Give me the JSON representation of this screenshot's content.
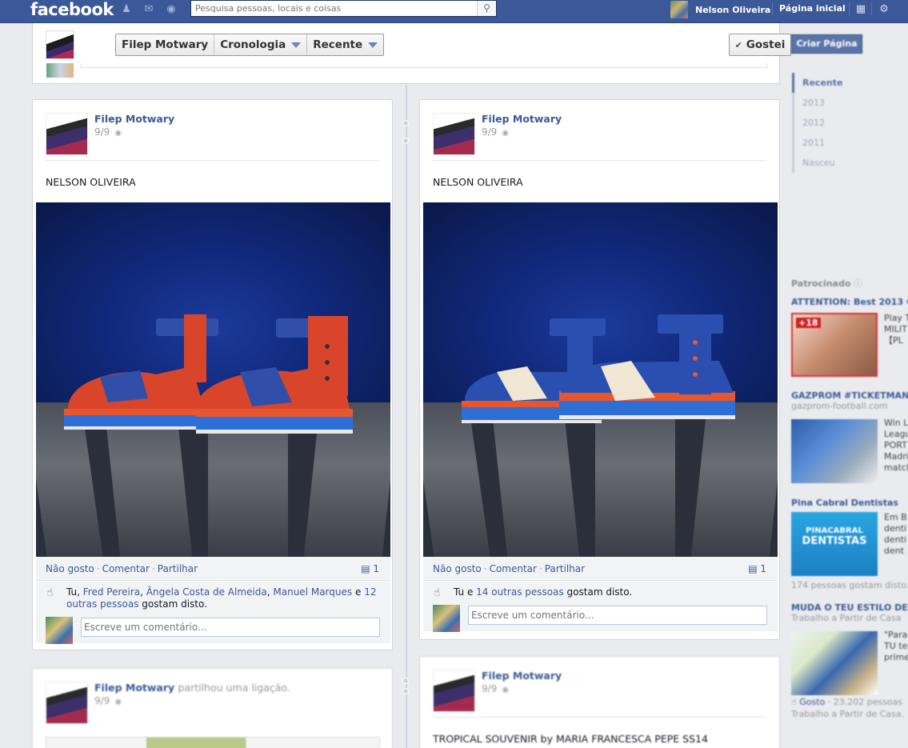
{
  "topbar": {
    "logo": "facebook",
    "search_placeholder": "Pesquisa pessoas, locais e coisas",
    "user_name": "Nelson Oliveira",
    "home_label": "Página inicial"
  },
  "header": {
    "page_name_btn": "Filep Motwary",
    "timeline_btn": "Cronologia",
    "recent_btn": "Recente",
    "like_btn": "Gostei"
  },
  "posts": [
    {
      "author": "Filep Motwary",
      "date": "9/9",
      "text": "NELSON OLIVEIRA",
      "actions": {
        "unlike": "Não gosto",
        "comment": "Comentar",
        "share": "Partilhar",
        "comment_count": "1"
      },
      "likes": {
        "you": "Tu",
        "sep1": ",",
        "friend1": "Fred Pereira",
        "sep2": ",",
        "friend2": "Ângela Costa de Almeida",
        "sep3": ",",
        "friend3": "Manuel Marques",
        "and": "e",
        "others": "12 outras pessoas",
        "suffix": "gostam disto."
      },
      "comment_placeholder": "Escreve um comentário...",
      "shoe_colors": {
        "upper": "#d9452a",
        "strap": "#2f4fa8",
        "sole_top": "#e8562e",
        "sole_mid": "#2e6fd6",
        "sole_bottom": "#e8e8e8"
      }
    },
    {
      "author": "Filep Motwary",
      "date": "9/9",
      "text": "NELSON OLIVEIRA",
      "actions": {
        "unlike": "Não gosto",
        "comment": "Comentar",
        "share": "Partilhar",
        "comment_count": "1"
      },
      "likes": {
        "you": "Tu",
        "and": "e",
        "others": "14 outras pessoas",
        "suffix": "gostam disto."
      },
      "comment_placeholder": "Escreve um comentário...",
      "shoe_colors": {
        "upper": "#2a4fb0",
        "strap": "#2a4fb0",
        "accent": "#efe6d4",
        "sole_top": "#e8562e",
        "sole_mid": "#2e6fd6",
        "sole_bottom": "#e8e8e8"
      }
    },
    {
      "author": "Filep Motwary",
      "meta": "partilhou uma ligação.",
      "date": "9/9"
    },
    {
      "author": "Filep Motwary",
      "date": "9/9",
      "text": "TROPICAL SOUVENIR by MARIA FRANCESCA PEPE SS14"
    }
  ],
  "rightcol": {
    "create_page": "Criar Página",
    "years": [
      "Recente",
      "2013",
      "2012",
      "2011",
      "Nasceu"
    ],
    "sponsored": "Patrocinado",
    "ads": [
      {
        "title": "ATTENTION: Best 2013 G",
        "badge": "+18",
        "text": [
          "Play T",
          "MILIT",
          "【PL"
        ]
      },
      {
        "title": "GAZPROM #TICKETMAN",
        "sub": "gazprom-football.com",
        "text": [
          "Win L",
          "Leagu",
          "PORT",
          "Madri",
          "match"
        ]
      },
      {
        "title": "Pina Cabral Dentistas",
        "img_text": [
          "PINACABRAL",
          "DENTISTAS"
        ],
        "text": [
          "Em B",
          "denti",
          "denti",
          "dent"
        ],
        "foot": "174 pessoas gostam disto."
      },
      {
        "title": "MUDA O TEU ESTILO DE",
        "sub": "Trabalho a Partir de Casa",
        "text": [
          "\"Para",
          "TU te",
          "prime"
        ],
        "like": "Gosto",
        "foot": "23.202 pessoas",
        "foot2": "Trabalho a Partir de Casa."
      }
    ]
  },
  "colors": {
    "brand": "#3b5998",
    "link": "#3b5998",
    "bg": "#e9ebee"
  }
}
